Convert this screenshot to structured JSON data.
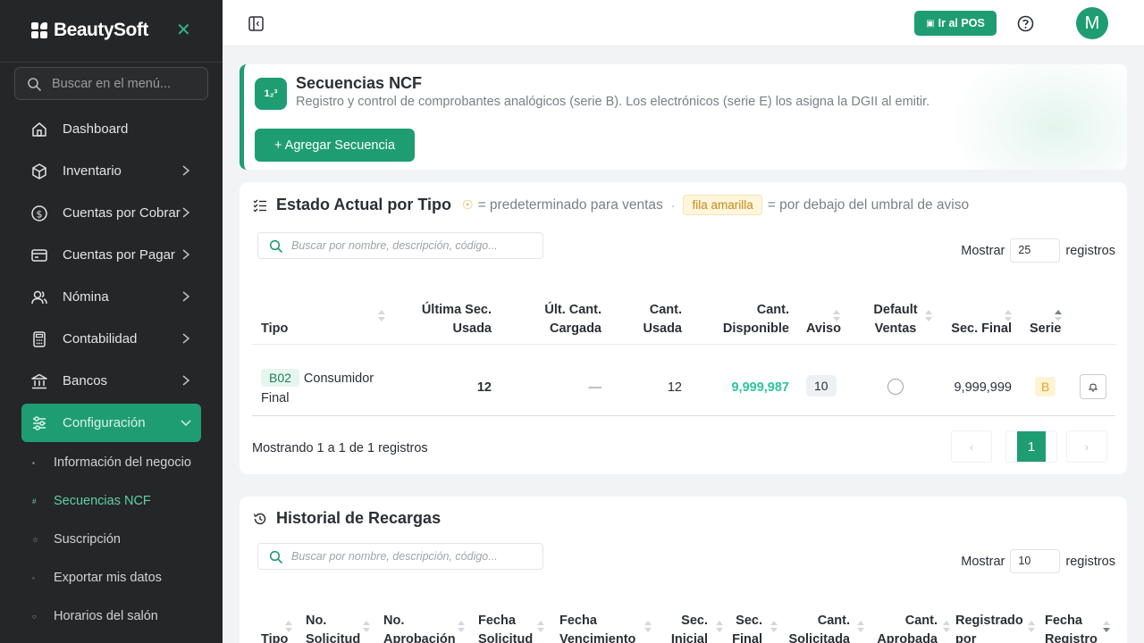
{
  "sidebar": {
    "brand": "BeautySoft",
    "search_placeholder": "Buscar en el menú...",
    "items": [
      {
        "label": "Dashboard"
      },
      {
        "label": "Inventario"
      },
      {
        "label": "Cuentas por Cobrar"
      },
      {
        "label": "Cuentas por Pagar"
      },
      {
        "label": "Nómina"
      },
      {
        "label": "Contabilidad"
      },
      {
        "label": "Bancos"
      },
      {
        "label": "Configuración"
      }
    ],
    "sub_items": [
      {
        "label": "Información del negocio"
      },
      {
        "label": "Secuencias NCF"
      },
      {
        "label": "Suscripción"
      },
      {
        "label": "Exportar mis datos"
      },
      {
        "label": "Horarios del salón"
      }
    ]
  },
  "topbar": {
    "pos_label": "Ir al POS",
    "avatar_initial": "M"
  },
  "header": {
    "icon_text": "1₂³",
    "title": "Secuencias NCF",
    "subtitle": "Registro y control de comprobantes analógicos (serie B). Los electrónicos (serie E) los asigna la DGII al emitir.",
    "add_button": "+ Agregar Secuencia"
  },
  "estado": {
    "title": "Estado Actual por Tipo",
    "legend_default": "= predeterminado para ventas",
    "legend_sep": "·",
    "legend_badge": "fila amarilla",
    "legend_threshold": "= por debajo del umbral de aviso",
    "search_placeholder": "Buscar por nombre, descripción, código...",
    "show_label": "Mostrar",
    "show_value": "25",
    "records_label": "registros",
    "columns": {
      "tipo": "Tipo",
      "ultima_sec_1": "Última Sec.",
      "ultima_sec_2": "Usada",
      "ult_cant_1": "Últ. Cant.",
      "ult_cant_2": "Cargada",
      "cant_usada_1": "Cant.",
      "cant_usada_2": "Usada",
      "cant_disp_1": "Cant.",
      "cant_disp_2": "Disponible",
      "aviso": "Aviso",
      "default_1": "Default",
      "default_2": "Ventas",
      "sec_final": "Sec. Final",
      "serie": "Serie"
    },
    "rows": [
      {
        "code": "B02",
        "name_1": "Consumidor",
        "name_2": "Final",
        "ultima_sec": "12",
        "ult_cant": "—",
        "cant_usada": "12",
        "cant_disponible": "9,999,987",
        "aviso": "10",
        "sec_final": "9,999,999",
        "serie": "B"
      }
    ],
    "footer": "Mostrando 1 a 1 de 1 registros",
    "pager_prev": "‹",
    "pager_page": "1",
    "pager_next": "›",
    "colors": {
      "accent": "#1f9d72",
      "available": "#2ec4a0",
      "serie": "#e1a626"
    }
  },
  "historial": {
    "title": "Historial de Recargas",
    "search_placeholder": "Buscar por nombre, descripción, código...",
    "show_label": "Mostrar",
    "show_value": "10",
    "records_label": "registros",
    "columns": {
      "tipo": "Tipo",
      "no_sol_1": "No.",
      "no_sol_2": "Solicitud",
      "no_apr_1": "No.",
      "no_apr_2": "Aprobación",
      "f_sol_1": "Fecha",
      "f_sol_2": "Solicitud",
      "f_ven_1": "Fecha",
      "f_ven_2": "Vencimiento",
      "sec_ini_1": "Sec.",
      "sec_ini_2": "Inicial",
      "sec_fin_1": "Sec.",
      "sec_fin_2": "Final",
      "c_sol_1": "Cant.",
      "c_sol_2": "Solicitada",
      "c_apr_1": "Cant.",
      "c_apr_2": "Aprobada",
      "reg_1": "Registrado",
      "reg_2": "por",
      "f_reg_1": "Fecha",
      "f_reg_2": "Registro"
    }
  }
}
